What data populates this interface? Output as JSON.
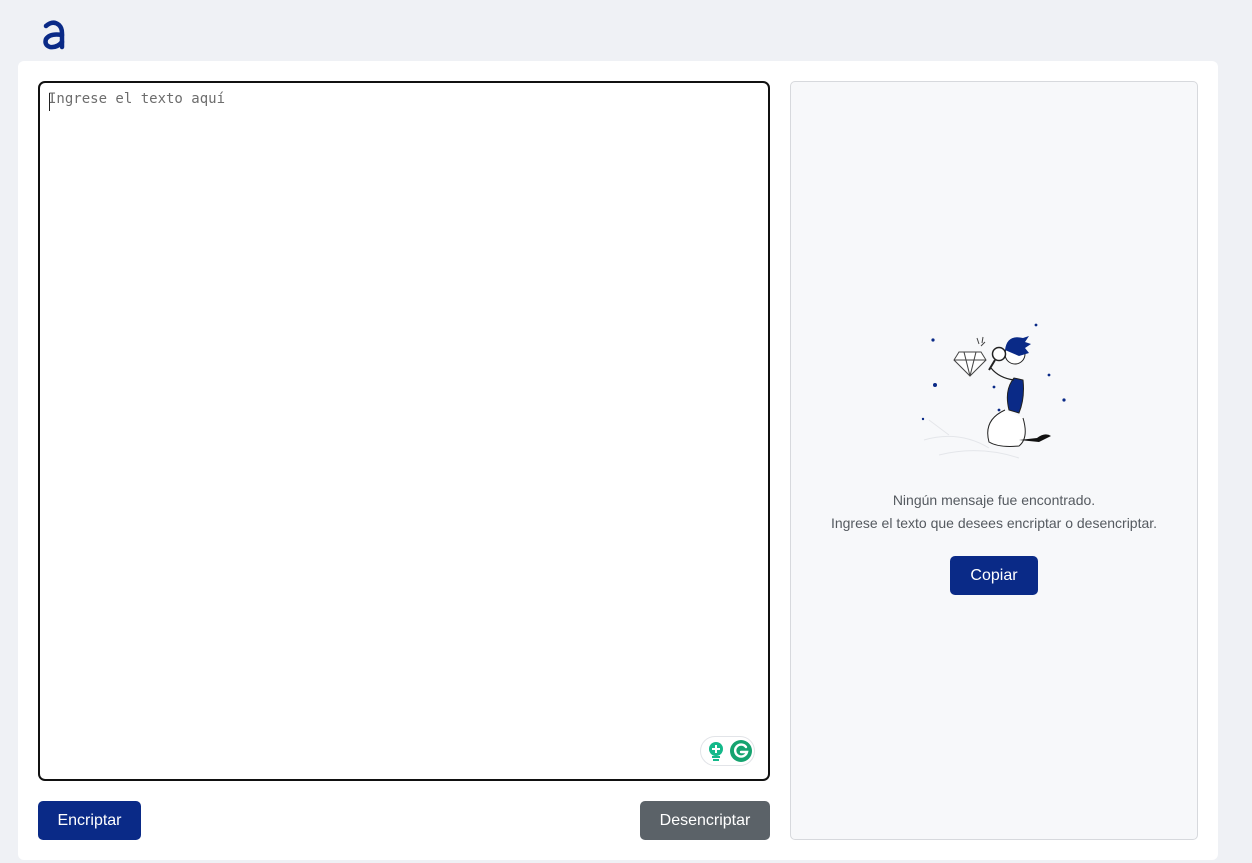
{
  "app": {
    "logo_icon": "alura-logo-icon",
    "brand_color": "#0a2a87"
  },
  "editor": {
    "placeholder": "Ingrese el texto aquí",
    "value": "",
    "grammarly_icons": [
      "grammarly-lightbulb-icon",
      "grammarly-g-icon"
    ]
  },
  "actions": {
    "encrypt_label": "Encriptar",
    "decrypt_label": "Desencriptar",
    "encrypt_color": "#0a2a87",
    "decrypt_color": "#5b6268"
  },
  "result": {
    "illustration": "person-with-magnifier-diamond-illustration",
    "title": "Ningún mensaje fue encontrado.",
    "body": "Ingrese el texto que desees encriptar o desencriptar.",
    "copy_label": "Copiar"
  }
}
